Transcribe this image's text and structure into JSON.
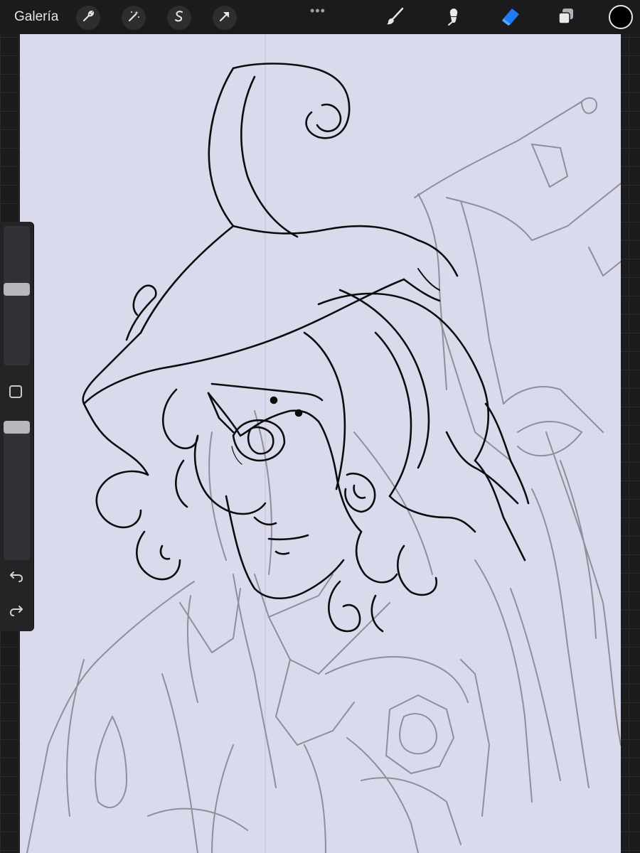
{
  "topbar": {
    "gallery_label": "Galería",
    "left_tools": [
      {
        "name": "actions-wrench-icon"
      },
      {
        "name": "adjustments-wand-icon"
      },
      {
        "name": "selection-s-icon"
      },
      {
        "name": "transform-arrow-icon"
      }
    ],
    "more_dots": "•••",
    "right_tools": [
      {
        "name": "brush-icon",
        "active": false
      },
      {
        "name": "smudge-icon",
        "active": false
      },
      {
        "name": "eraser-icon",
        "active": true
      },
      {
        "name": "layers-icon",
        "active": false
      }
    ],
    "current_color": "#000000",
    "active_tool_color": "#1e7cf2"
  },
  "sidebar": {
    "brush_size_level": 0.55,
    "opacity_level": 1.0,
    "undo_icon": "undo-icon",
    "redo_icon": "redo-icon"
  },
  "canvas": {
    "background_color": "#d9dbec",
    "lineart_color": "#0c0c0e",
    "sketch_color": "#8e8f99"
  }
}
